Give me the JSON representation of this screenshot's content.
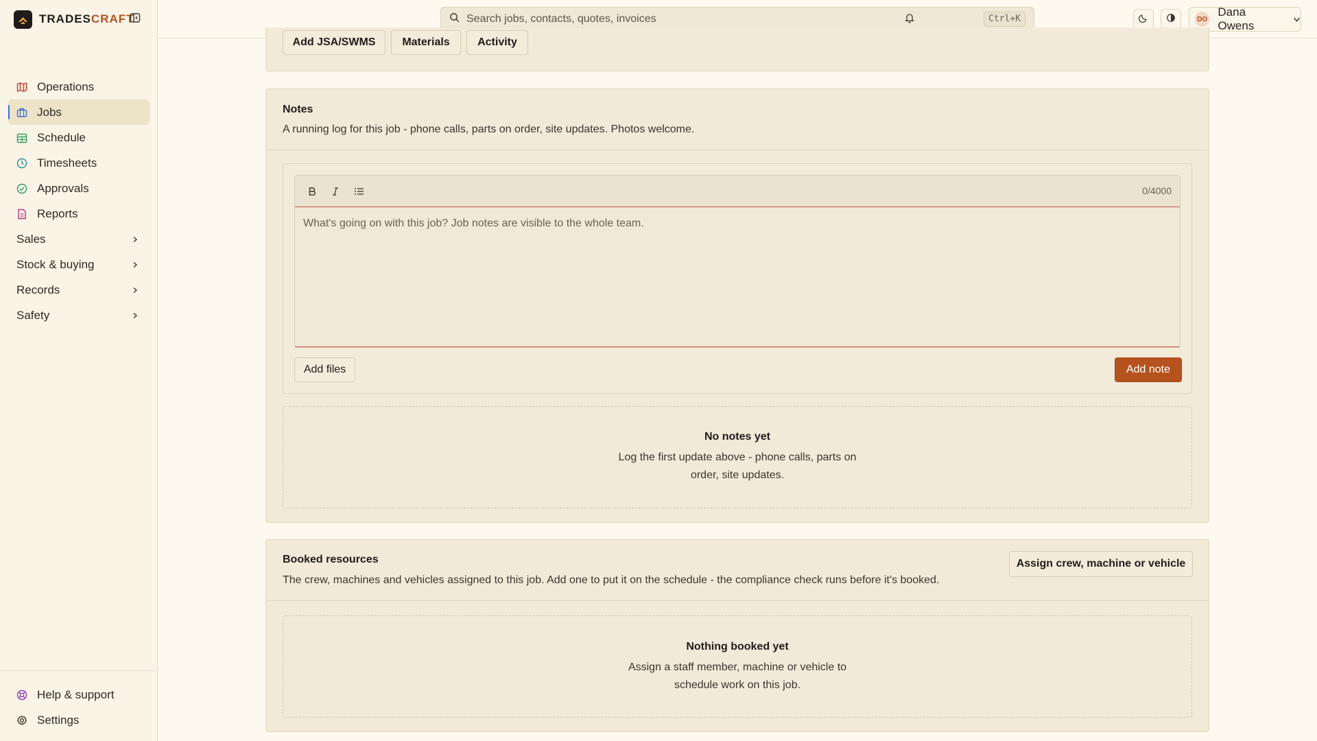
{
  "brand": {
    "name_main": "TRADES",
    "name_accent": "CRAFT"
  },
  "sidebar": {
    "items": [
      {
        "label": "Operations",
        "icon": "map-icon",
        "color": "#c0392b"
      },
      {
        "label": "Jobs",
        "icon": "briefcase-icon",
        "color": "#3b6fd0",
        "active": true
      },
      {
        "label": "Schedule",
        "icon": "calendar-icon",
        "color": "#2e9e5b"
      },
      {
        "label": "Timesheets",
        "icon": "clock-icon",
        "color": "#1f8fa8"
      },
      {
        "label": "Approvals",
        "icon": "check-circle-icon",
        "color": "#2e9e5b"
      },
      {
        "label": "Reports",
        "icon": "report-icon",
        "color": "#b0357e"
      }
    ],
    "groups": [
      {
        "label": "Sales"
      },
      {
        "label": "Stock & buying"
      },
      {
        "label": "Records"
      },
      {
        "label": "Safety"
      }
    ],
    "bottom": [
      {
        "label": "Help & support",
        "icon": "lifebuoy-icon",
        "color": "#8a3fb5"
      },
      {
        "label": "Settings",
        "icon": "gear-icon",
        "color": "#3b352e"
      }
    ]
  },
  "topbar": {
    "search_placeholder": "Search jobs, contacts, quotes, invoices",
    "shortcut": "Ctrl+K",
    "user": {
      "initials": "DO",
      "name": "Dana Owens"
    }
  },
  "top_tabs": [
    "Add JSA/SWMS",
    "Materials",
    "Activity"
  ],
  "notes": {
    "title": "Notes",
    "description": "A running log for this job - phone calls, parts on order, site updates. Photos welcome.",
    "counter": "0/4000",
    "placeholder": "What's going on with this job? Job notes are visible to the whole team.",
    "add_files": "Add files",
    "add_note": "Add note",
    "empty_title": "No notes yet",
    "empty_line1": "Log the first update above - phone calls, parts on",
    "empty_line2": "order, site updates."
  },
  "resources": {
    "title": "Booked resources",
    "description": "The crew, machines and vehicles assigned to this job. Add one to put it on the schedule - the compliance check runs before it's booked.",
    "assign_button": "Assign crew, machine or vehicle",
    "empty_title": "Nothing booked yet",
    "empty_line1": "Assign a staff member, machine or vehicle to",
    "empty_line2": "schedule work on this job."
  },
  "colors": {
    "accent": "#b5521d",
    "primary_button": "#b5521d"
  }
}
